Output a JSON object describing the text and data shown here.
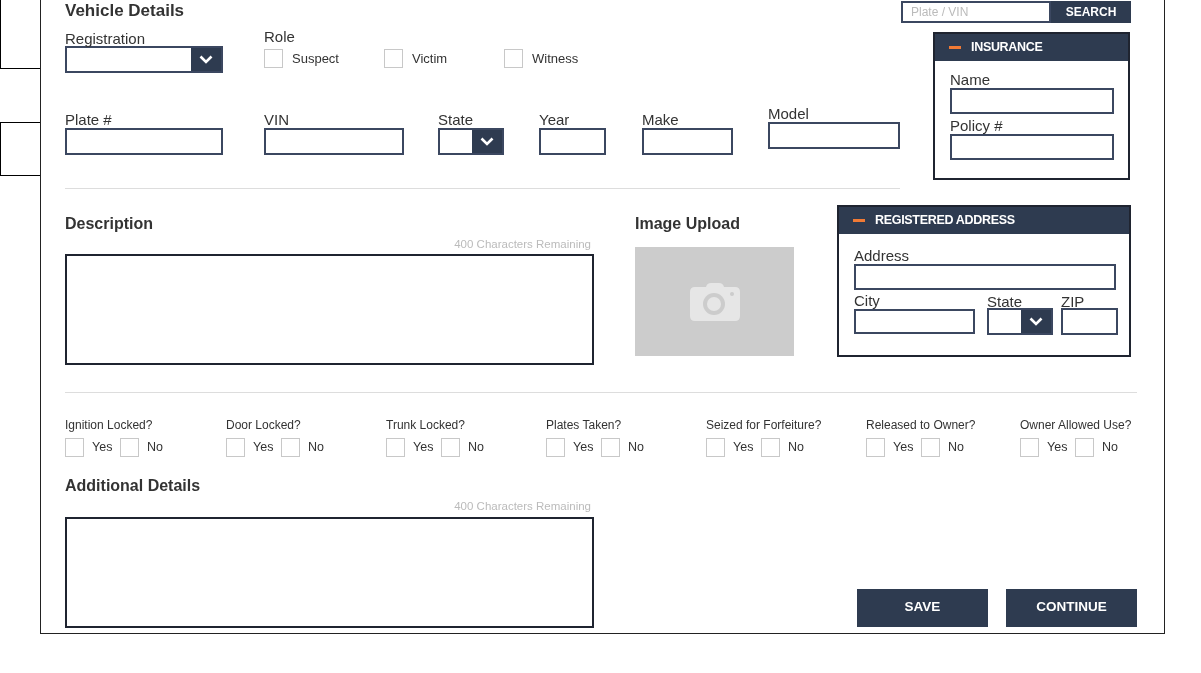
{
  "section_title": "Vehicle Details",
  "search": {
    "placeholder": "Plate / VIN",
    "button": "SEARCH"
  },
  "registration": {
    "label": "Registration"
  },
  "role": {
    "label": "Role",
    "options": [
      {
        "label": "Suspect",
        "checked": false
      },
      {
        "label": "Victim",
        "checked": false
      },
      {
        "label": "Witness",
        "checked": false
      }
    ]
  },
  "vehicle_fields": [
    {
      "label": "Plate #",
      "kind": "text"
    },
    {
      "label": "VIN",
      "kind": "text"
    },
    {
      "label": "State",
      "kind": "select"
    },
    {
      "label": "Year",
      "kind": "text"
    },
    {
      "label": "Make",
      "kind": "text"
    },
    {
      "label": "Model",
      "kind": "text"
    }
  ],
  "insurance": {
    "title": "INSURANCE",
    "expanded": true,
    "fields": [
      {
        "label": "Name",
        "kind": "text"
      },
      {
        "label": "Policy #",
        "kind": "text"
      }
    ]
  },
  "description": {
    "label": "Description",
    "counter": "400 Characters Remaining"
  },
  "image_upload": {
    "label": "Image Upload"
  },
  "registered_address": {
    "title": "REGISTERED ADDRESS",
    "expanded": true,
    "fields": [
      {
        "label": "Address",
        "kind": "text"
      },
      {
        "label": "City",
        "kind": "text"
      },
      {
        "label": "State",
        "kind": "select"
      },
      {
        "label": "ZIP",
        "kind": "text"
      }
    ]
  },
  "questions": [
    {
      "label": "Ignition Locked?",
      "options": [
        {
          "label": "Yes",
          "checked": false
        },
        {
          "label": "No",
          "checked": false
        }
      ]
    },
    {
      "label": "Door Locked?",
      "options": [
        {
          "label": "Yes",
          "checked": false
        },
        {
          "label": "No",
          "checked": false
        }
      ]
    },
    {
      "label": "Trunk Locked?",
      "options": [
        {
          "label": "Yes",
          "checked": false
        },
        {
          "label": "No",
          "checked": false
        }
      ]
    },
    {
      "label": "Plates Taken?",
      "options": [
        {
          "label": "Yes",
          "checked": false
        },
        {
          "label": "No",
          "checked": false
        }
      ]
    },
    {
      "label": "Seized for Forfeiture?",
      "options": [
        {
          "label": "Yes",
          "checked": false
        },
        {
          "label": "No",
          "checked": false
        }
      ]
    },
    {
      "label": "Released to Owner?",
      "options": [
        {
          "label": "Yes",
          "checked": false
        },
        {
          "label": "No",
          "checked": false
        }
      ]
    },
    {
      "label": "Owner Allowed Use?",
      "options": [
        {
          "label": "Yes",
          "checked": false
        },
        {
          "label": "No",
          "checked": false
        }
      ]
    }
  ],
  "additional_details": {
    "label": "Additional Details",
    "counter": "400 Characters Remaining"
  },
  "buttons": [
    "SAVE",
    "CONTINUE"
  ]
}
